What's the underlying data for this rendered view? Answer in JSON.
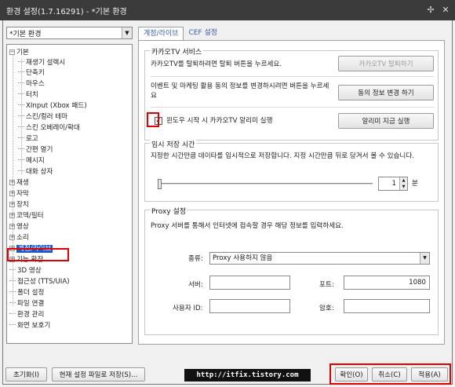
{
  "window": {
    "title": "환경 설정(1.7.16291) - *기본 환경",
    "pin_icon": "pin-icon",
    "close_icon": "close-icon"
  },
  "preset": {
    "value": "*기본 환경"
  },
  "tree": {
    "root": "기본",
    "children": [
      "재생기 설렉시",
      "단축키",
      "마우스",
      "터치",
      "XInput (Xbox 패드)",
      "스킨/컬러 테마",
      "스킨 오베레이/확대",
      "로고",
      "간편 열기",
      "메시지",
      "대화 상자"
    ],
    "sections": [
      "재생",
      "자막",
      "장치",
      "코덱/필터",
      "영상",
      "소리",
      "계정/라이브",
      "기능 확장"
    ],
    "leaves": [
      "3D 영상",
      "접근성 (TTS/UIA)",
      "폴더 설정",
      "파일 연결",
      "환경 관리",
      "화면 보호기"
    ]
  },
  "tabs": [
    "계정/라이브",
    "CEF 설정"
  ],
  "kakao": {
    "title": "카카오TV 서비스",
    "leave_text": "카카오TV를 탈퇴하려면 탈퇴 버튼을 누르세요.",
    "leave_button": "카카오TV 탈퇴하기",
    "consent_text": "이벤트 및 마케팅 활용 동의 정보를 변경하시려면 버튼을 누르세요",
    "consent_button": "동의 정보 변경 하기",
    "alarm_checkbox": "윈도우 시작 시 카카오TV 알리미 실행",
    "alarm_checked": true,
    "alarm_button": "알리미 지금 실행"
  },
  "temp": {
    "title": "임시 저장 시간",
    "desc": "지정한 시간만큼 데이타를 임시적으로 저장합니다. 지정 시간만큼 뒤로 당겨서 볼 수 있습니다.",
    "slider_value": 0.0,
    "minutes": "1",
    "unit": "분"
  },
  "proxy": {
    "title": "Proxy 설정",
    "desc": "Proxy 서버를 통해서 인터넷에 접속할 경우 해당 정보를 입력하세요.",
    "type_label": "종류:",
    "type_value": "Proxy 사용하지 않음",
    "server_label": "서버:",
    "server_value": "",
    "port_label": "포트:",
    "port_value": "1080",
    "user_label": "사용자 ID:",
    "user_value": "",
    "password_label": "암호:",
    "password_value": ""
  },
  "footer": {
    "reset": "초기화(I)",
    "save_as": "현재 설정 파일로 저장(S)...",
    "url": "http://itfix.tistory.com",
    "ok": "확인(O)",
    "cancel": "취소(C)",
    "apply": "적용(A)"
  },
  "colors": {
    "highlight": "#e00000",
    "selection": "#1b58c8"
  }
}
